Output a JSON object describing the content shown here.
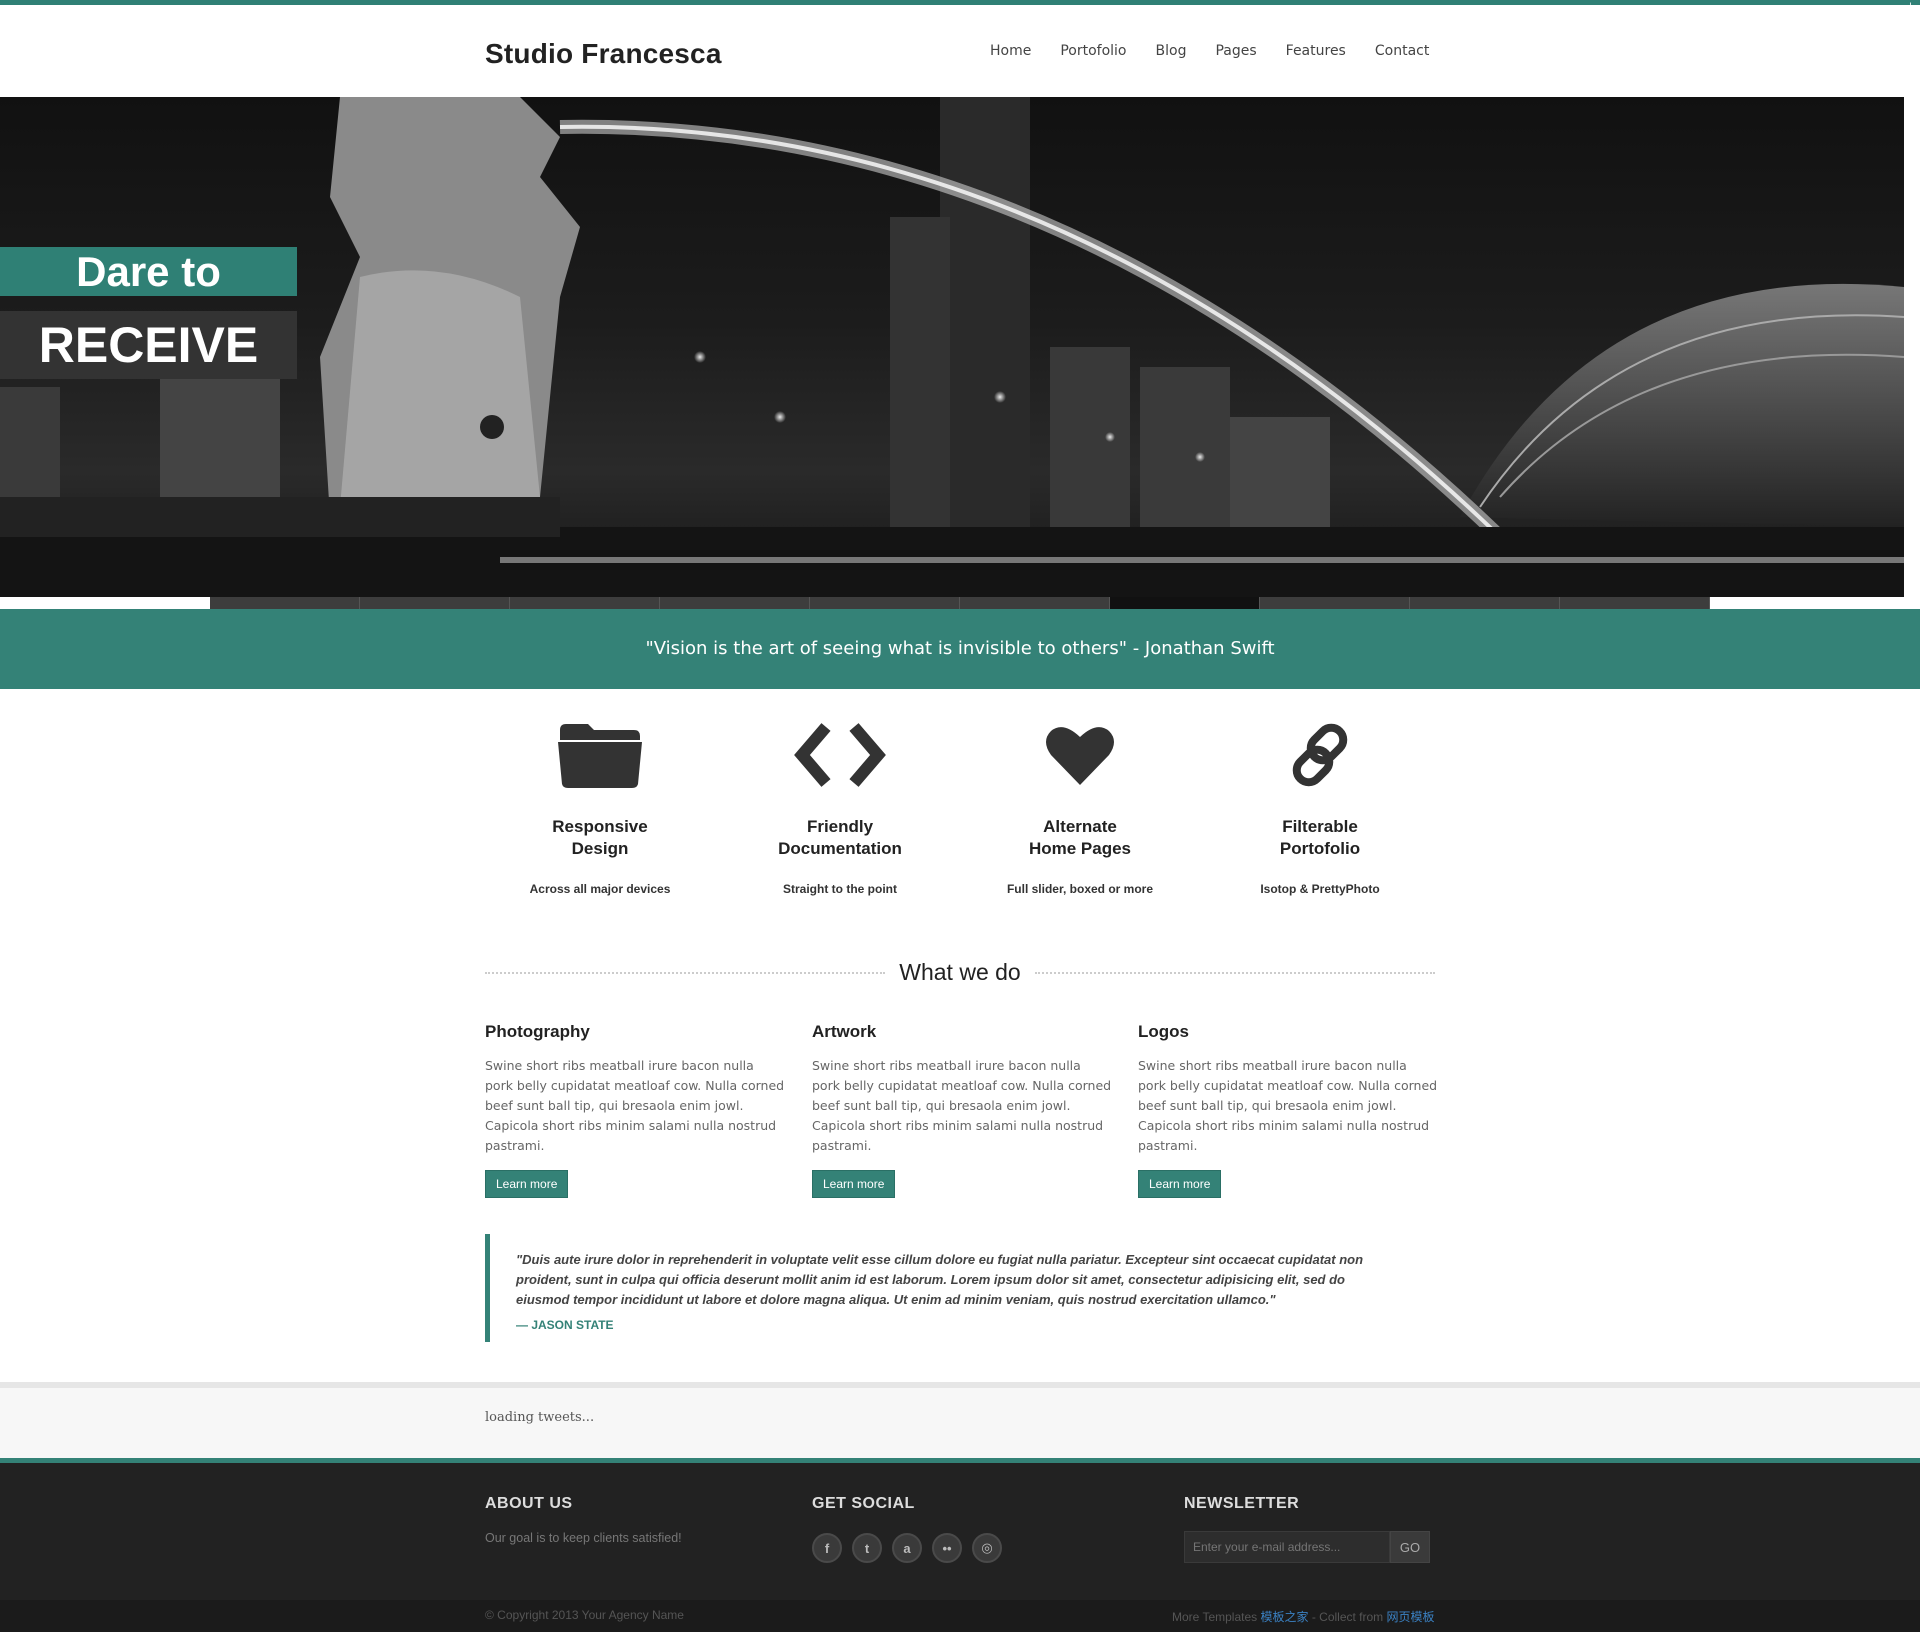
{
  "brand": {
    "name": "Studio Francesca",
    "accent": "#348277"
  },
  "nav": [
    "Home",
    "Portofolio",
    "Blog",
    "Pages",
    "Features",
    "Contact"
  ],
  "corner_button": "+",
  "hero": {
    "line1": "Dare to",
    "line2": "RECEIVE",
    "slider_count": 10,
    "active_slide": 7
  },
  "quote_band": "\"Vision is the art of seeing what is invisible to others\" - Jonathan Swift",
  "features": [
    {
      "icon": "folder-icon",
      "title_l1": "Responsive",
      "title_l2": "Design",
      "desc": "Across all major devices"
    },
    {
      "icon": "code-icon",
      "title_l1": "Friendly",
      "title_l2": "Documentation",
      "desc": "Straight to the point"
    },
    {
      "icon": "heart-icon",
      "title_l1": "Alternate",
      "title_l2": "Home Pages",
      "desc": "Full slider, boxed or more"
    },
    {
      "icon": "link-icon",
      "title_l1": "Filterable",
      "title_l2": "Portofolio",
      "desc": "Isotop & PrettyPhoto"
    }
  ],
  "what_we_do": {
    "title": "What we do",
    "items": [
      {
        "title": "Photography",
        "text": "Swine short ribs meatball irure bacon nulla pork belly cupidatat meatloaf cow. Nulla corned beef sunt ball tip, qui bresaola enim jowl. Capicola short ribs minim salami nulla nostrud pastrami.",
        "button": "Learn more"
      },
      {
        "title": "Artwork",
        "text": "Swine short ribs meatball irure bacon nulla pork belly cupidatat meatloaf cow. Nulla corned beef sunt ball tip, qui bresaola enim jowl. Capicola short ribs minim salami nulla nostrud pastrami.",
        "button": "Learn more"
      },
      {
        "title": "Logos",
        "text": "Swine short ribs meatball irure bacon nulla pork belly cupidatat meatloaf cow. Nulla corned beef sunt ball tip, qui bresaola enim jowl. Capicola short ribs minim salami nulla nostrud pastrami.",
        "button": "Learn more"
      }
    ]
  },
  "testimonial": {
    "text": "\"Duis aute irure dolor in reprehenderit in voluptate velit esse cillum dolore eu fugiat nulla pariatur. Excepteur sint occaecat cupidatat non proident, sunt in culpa qui officia deserunt mollit anim id est laborum. Lorem ipsum dolor sit amet, consectetur adipisicing elit, sed do eiusmod tempor incididunt ut labore et dolore magna aliqua. Ut enim ad minim veniam, quis nostrud exercitation ullamco.\"",
    "author": "— JASON STATE"
  },
  "tweets": {
    "status": "loading tweets..."
  },
  "footer": {
    "about_title": "ABOUT US",
    "about_text": "Our goal is to keep clients satisfied!",
    "social_title": "GET SOCIAL",
    "socials": [
      {
        "icon": "facebook-icon",
        "glyph": "f"
      },
      {
        "icon": "twitter-icon",
        "glyph": "t"
      },
      {
        "icon": "deviantart-icon",
        "glyph": "a"
      },
      {
        "icon": "flickr-icon",
        "glyph": "••"
      },
      {
        "icon": "dribbble-icon",
        "glyph": "◎"
      }
    ],
    "newsletter_title": "NEWSLETTER",
    "newsletter_placeholder": "Enter your e-mail address...",
    "newsletter_button": "GO"
  },
  "copyright": {
    "left": "© Copyright 2013 Your Agency Name",
    "right_prefix": "More Templates ",
    "right_link1": "模板之家",
    "right_mid": " - Collect from ",
    "right_link2": "网页模板"
  }
}
